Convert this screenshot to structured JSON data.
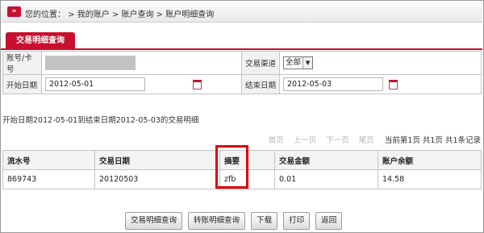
{
  "breadcrumb": {
    "text": "您的位置： > 我的账户 > 账户查询 > 账户明细查询"
  },
  "tab": {
    "label": "交易明细查询"
  },
  "form": {
    "account_label": "账号/卡号",
    "channel_label": "交易渠道",
    "channel_value": "全部",
    "start_label": "开始日期",
    "start_value": "2012-05-01",
    "end_label": "结束日期",
    "end_value": "2012-05-03"
  },
  "range_text": "开始日期2012-05-01到结束日期2012-05-03的交易明细",
  "pager": {
    "first": "首页",
    "prev": "上一页",
    "next": "下一页",
    "last": "尾页",
    "info": "当前第1页 共1页 共1条记录"
  },
  "table": {
    "headers": [
      "流水号",
      "交易日期",
      "摘要",
      "交易金额",
      "账户余额"
    ],
    "rows": [
      [
        "869743",
        "20120503",
        "zfb",
        "0.01",
        "14.58"
      ]
    ]
  },
  "buttons": {
    "detail_query": "交易明细查询",
    "transfer_query": "转账明细查询",
    "download": "下载",
    "print": "打印",
    "back": "返回"
  }
}
